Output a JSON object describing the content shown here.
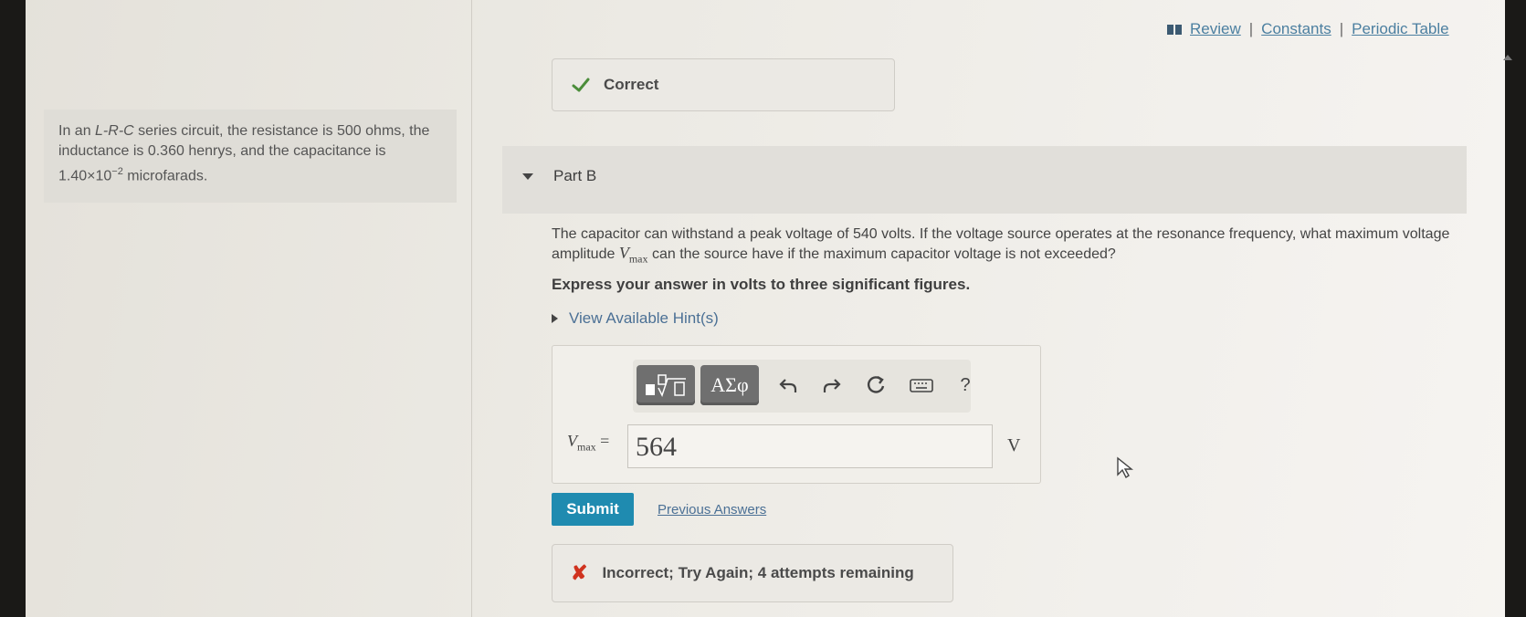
{
  "nav": {
    "review": "Review",
    "separator": "|",
    "constants": "Constants",
    "periodic_table": "Periodic Table",
    "icon": "book-icon"
  },
  "status_correct": "Correct",
  "problem": {
    "intro": "In an ",
    "circuit_type": "L-R-C",
    "text1": " series circuit, the resistance is 500 ohms, the inductance is 0.360 henrys, and the capacitance is ",
    "cap_mantissa": "1.40×10",
    "cap_exp": "−2",
    "cap_unit": " microfarads."
  },
  "part": {
    "label": "Part B"
  },
  "question": {
    "text1": "The capacitor can withstand a peak voltage of 540 volts. If the voltage source operates at the resonance frequency, what maximum voltage amplitude ",
    "var": "V",
    "var_sub": "max",
    "text2": " can the source have if the maximum capacitor voltage is not exceeded?"
  },
  "instruction": "Express your answer in volts to three significant figures.",
  "hints_label": "View Available Hint(s)",
  "toolbar": {
    "templates_icon": "templates-icon",
    "greek_label": "ΑΣφ",
    "undo": "undo-icon",
    "redo": "redo-icon",
    "reset": "reset-icon",
    "keyboard": "keyboard-icon",
    "help": "?"
  },
  "answer": {
    "var": "V",
    "var_sub": "max",
    "equals": " =",
    "value": "564",
    "unit": "V"
  },
  "submit_label": "Submit",
  "previous_answers": "Previous Answers",
  "feedback": {
    "icon": "✘",
    "text": "Incorrect; Try Again; 4 attempts remaining"
  },
  "colors": {
    "submit": "#1f8bb0",
    "error": "#d0331f",
    "link": "#4b7fa0"
  }
}
